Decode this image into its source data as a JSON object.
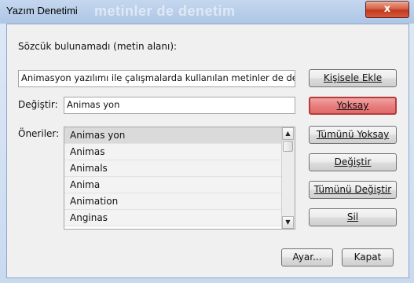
{
  "window": {
    "title": "Yazım Denetimi",
    "background_text": "metinler de denetim",
    "close_symbol": "x"
  },
  "header_label": "Sözcük bulunamadı (metin alanı):",
  "context_field": {
    "value": "Animasyon yazılımı ile çalışmalarda kullanılan metinler de dene"
  },
  "change_to": {
    "label": "Değiştir:",
    "value": "Animas yon"
  },
  "suggestions": {
    "label": "Öneriler:",
    "items": [
      "Animas yon",
      "Animas",
      "Animals",
      "Anima",
      "Animation",
      "Anginas"
    ],
    "selected_index": 0
  },
  "buttons": {
    "add_to_personal": "Kişisele Ekle",
    "ignore": "Yoksay",
    "ignore_all": "Tümünü Yoksay",
    "change": "Değiştir",
    "change_all": "Tümünü Değiştir",
    "delete": "Sil",
    "settings": "Ayar...",
    "close": "Kapat"
  },
  "colors": {
    "active_button": "#e06a6a",
    "titlebar": "#b7cde9",
    "close_button": "#c2391f"
  },
  "icons": {
    "scroll_up": "▲",
    "scroll_down": "▼"
  }
}
